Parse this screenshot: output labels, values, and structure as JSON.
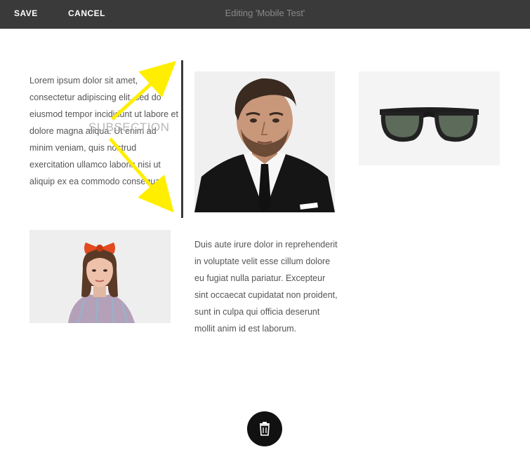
{
  "toolbar": {
    "save_label": "SAVE",
    "cancel_label": "CANCEL",
    "title": "Editing 'Mobile Test'"
  },
  "content": {
    "text_block_1": "Lorem ipsum dolor sit amet, consectetur adipiscing elit, sed do eiusmod tempor incididunt ut labore et dolore magna aliqua. Ut enim ad minim veniam, quis nostrud exercitation ullamco laboris nisi ut aliquip ex ea commodo consequat.",
    "text_block_2": "Duis aute irure dolor in reprehenderit in voluptate velit esse cillum dolore eu fugiat nulla pariatur. Excepteur sint occaecat cupidatat non proident, sunt in culpa qui officia deserunt mollit anim id est laborum.",
    "subsection_label": "SUBSECTION"
  },
  "images": {
    "man": "man-in-suit-photo",
    "glasses": "sunglasses-photo",
    "woman": "woman-with-red-bow-photo"
  },
  "icons": {
    "delete": "trash-icon",
    "arrows": "yellow-arrow-icon"
  },
  "colors": {
    "toolbar_bg": "#3a3a3a",
    "arrow": "#ffee00",
    "delete_button_bg": "#111111"
  }
}
